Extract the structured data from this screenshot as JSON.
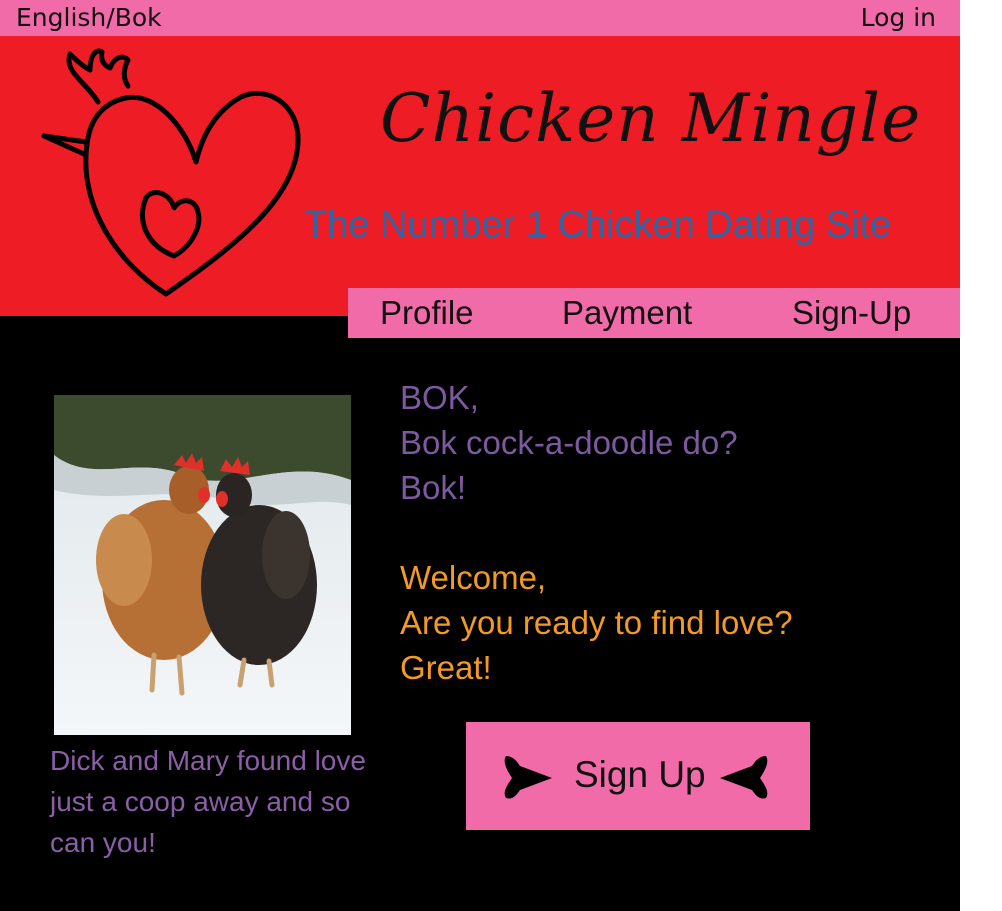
{
  "topbar": {
    "language_label": "English/Bok",
    "login_label": "Log in"
  },
  "header": {
    "title": "Chicken Mingle",
    "tagline": "The Number 1 Chicken Dating Site",
    "logo_icon": "chicken-heart-logo-icon"
  },
  "nav": {
    "items": [
      {
        "label": "Profile"
      },
      {
        "label": "Payment"
      },
      {
        "label": "Sign-Up"
      }
    ]
  },
  "photo": {
    "caption": "Dick and Mary found love just a coop away and so can you!"
  },
  "greeting": {
    "bok_lines": [
      "BOK,",
      "Bok cock-a-doodle do?",
      "Bok!"
    ],
    "english_lines": [
      "Welcome,",
      "Are you ready to find love?",
      "Great!"
    ]
  },
  "cta": {
    "label": "Sign Up",
    "left_icon": "heart-arrow-right-icon",
    "right_icon": "heart-arrow-left-icon"
  },
  "colors": {
    "pink": "#f06ba8",
    "red": "#ee1c25",
    "purple": "#7d59a0",
    "orange": "#f29a26",
    "blue": "#2a67a6"
  }
}
